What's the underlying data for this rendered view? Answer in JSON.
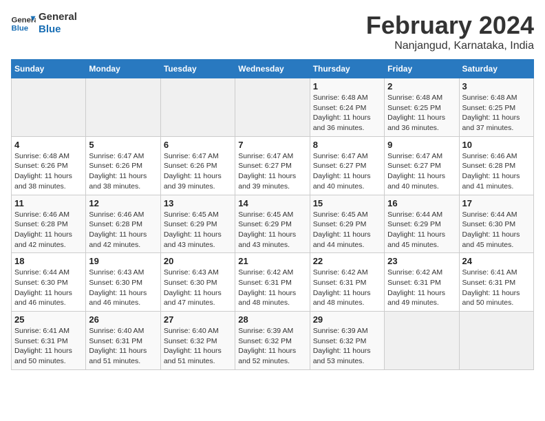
{
  "header": {
    "logo_line1": "General",
    "logo_line2": "Blue",
    "month": "February 2024",
    "location": "Nanjangud, Karnataka, India"
  },
  "weekdays": [
    "Sunday",
    "Monday",
    "Tuesday",
    "Wednesday",
    "Thursday",
    "Friday",
    "Saturday"
  ],
  "weeks": [
    [
      {
        "day": "",
        "info": ""
      },
      {
        "day": "",
        "info": ""
      },
      {
        "day": "",
        "info": ""
      },
      {
        "day": "",
        "info": ""
      },
      {
        "day": "1",
        "info": "Sunrise: 6:48 AM\nSunset: 6:24 PM\nDaylight: 11 hours\nand 36 minutes."
      },
      {
        "day": "2",
        "info": "Sunrise: 6:48 AM\nSunset: 6:25 PM\nDaylight: 11 hours\nand 36 minutes."
      },
      {
        "day": "3",
        "info": "Sunrise: 6:48 AM\nSunset: 6:25 PM\nDaylight: 11 hours\nand 37 minutes."
      }
    ],
    [
      {
        "day": "4",
        "info": "Sunrise: 6:48 AM\nSunset: 6:26 PM\nDaylight: 11 hours\nand 38 minutes."
      },
      {
        "day": "5",
        "info": "Sunrise: 6:47 AM\nSunset: 6:26 PM\nDaylight: 11 hours\nand 38 minutes."
      },
      {
        "day": "6",
        "info": "Sunrise: 6:47 AM\nSunset: 6:26 PM\nDaylight: 11 hours\nand 39 minutes."
      },
      {
        "day": "7",
        "info": "Sunrise: 6:47 AM\nSunset: 6:27 PM\nDaylight: 11 hours\nand 39 minutes."
      },
      {
        "day": "8",
        "info": "Sunrise: 6:47 AM\nSunset: 6:27 PM\nDaylight: 11 hours\nand 40 minutes."
      },
      {
        "day": "9",
        "info": "Sunrise: 6:47 AM\nSunset: 6:27 PM\nDaylight: 11 hours\nand 40 minutes."
      },
      {
        "day": "10",
        "info": "Sunrise: 6:46 AM\nSunset: 6:28 PM\nDaylight: 11 hours\nand 41 minutes."
      }
    ],
    [
      {
        "day": "11",
        "info": "Sunrise: 6:46 AM\nSunset: 6:28 PM\nDaylight: 11 hours\nand 42 minutes."
      },
      {
        "day": "12",
        "info": "Sunrise: 6:46 AM\nSunset: 6:28 PM\nDaylight: 11 hours\nand 42 minutes."
      },
      {
        "day": "13",
        "info": "Sunrise: 6:45 AM\nSunset: 6:29 PM\nDaylight: 11 hours\nand 43 minutes."
      },
      {
        "day": "14",
        "info": "Sunrise: 6:45 AM\nSunset: 6:29 PM\nDaylight: 11 hours\nand 43 minutes."
      },
      {
        "day": "15",
        "info": "Sunrise: 6:45 AM\nSunset: 6:29 PM\nDaylight: 11 hours\nand 44 minutes."
      },
      {
        "day": "16",
        "info": "Sunrise: 6:44 AM\nSunset: 6:29 PM\nDaylight: 11 hours\nand 45 minutes."
      },
      {
        "day": "17",
        "info": "Sunrise: 6:44 AM\nSunset: 6:30 PM\nDaylight: 11 hours\nand 45 minutes."
      }
    ],
    [
      {
        "day": "18",
        "info": "Sunrise: 6:44 AM\nSunset: 6:30 PM\nDaylight: 11 hours\nand 46 minutes."
      },
      {
        "day": "19",
        "info": "Sunrise: 6:43 AM\nSunset: 6:30 PM\nDaylight: 11 hours\nand 46 minutes."
      },
      {
        "day": "20",
        "info": "Sunrise: 6:43 AM\nSunset: 6:30 PM\nDaylight: 11 hours\nand 47 minutes."
      },
      {
        "day": "21",
        "info": "Sunrise: 6:42 AM\nSunset: 6:31 PM\nDaylight: 11 hours\nand 48 minutes."
      },
      {
        "day": "22",
        "info": "Sunrise: 6:42 AM\nSunset: 6:31 PM\nDaylight: 11 hours\nand 48 minutes."
      },
      {
        "day": "23",
        "info": "Sunrise: 6:42 AM\nSunset: 6:31 PM\nDaylight: 11 hours\nand 49 minutes."
      },
      {
        "day": "24",
        "info": "Sunrise: 6:41 AM\nSunset: 6:31 PM\nDaylight: 11 hours\nand 50 minutes."
      }
    ],
    [
      {
        "day": "25",
        "info": "Sunrise: 6:41 AM\nSunset: 6:31 PM\nDaylight: 11 hours\nand 50 minutes."
      },
      {
        "day": "26",
        "info": "Sunrise: 6:40 AM\nSunset: 6:31 PM\nDaylight: 11 hours\nand 51 minutes."
      },
      {
        "day": "27",
        "info": "Sunrise: 6:40 AM\nSunset: 6:32 PM\nDaylight: 11 hours\nand 51 minutes."
      },
      {
        "day": "28",
        "info": "Sunrise: 6:39 AM\nSunset: 6:32 PM\nDaylight: 11 hours\nand 52 minutes."
      },
      {
        "day": "29",
        "info": "Sunrise: 6:39 AM\nSunset: 6:32 PM\nDaylight: 11 hours\nand 53 minutes."
      },
      {
        "day": "",
        "info": ""
      },
      {
        "day": "",
        "info": ""
      }
    ]
  ]
}
